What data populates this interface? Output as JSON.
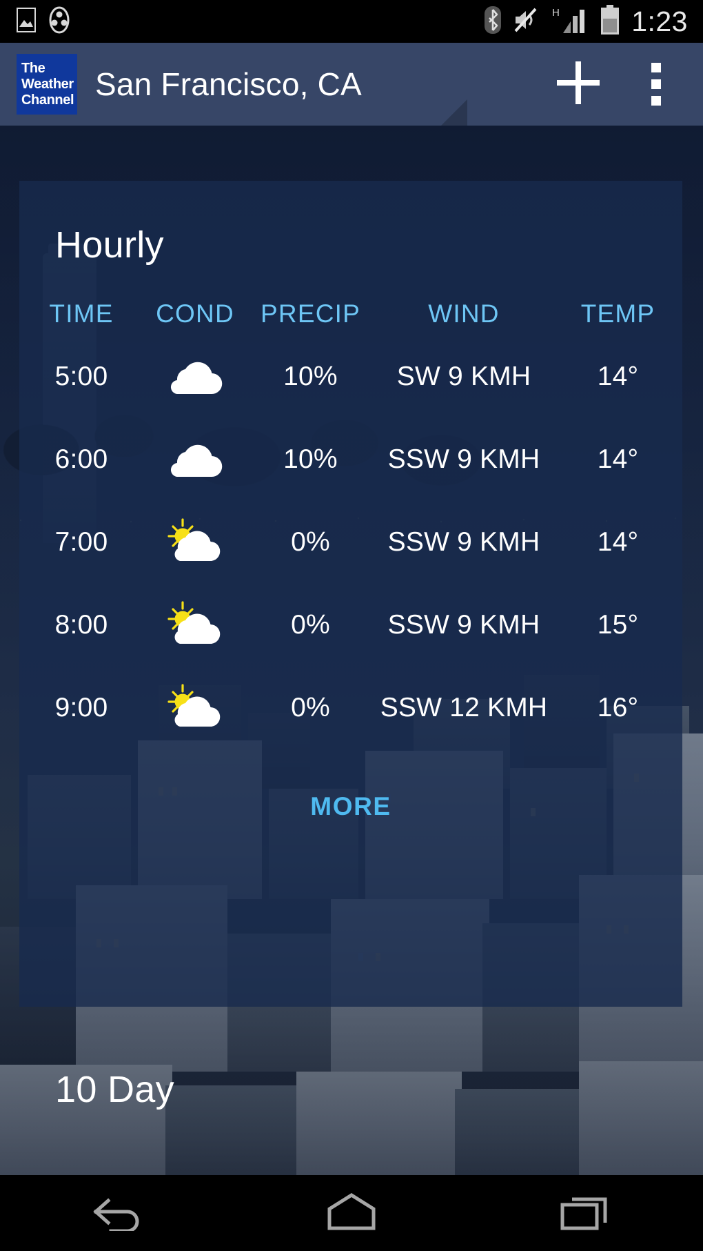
{
  "status_bar": {
    "icons": [
      "image-icon",
      "media-icon",
      "bluetooth-icon",
      "mute-icon",
      "hspa-signal-icon",
      "battery-icon"
    ],
    "network_letter": "H",
    "clock": "1:23"
  },
  "app_bar": {
    "logo_lines": [
      "The",
      "Weather",
      "Channel"
    ],
    "title": "San Francisco, CA",
    "add_label": "+",
    "overflow_label": "More options",
    "background_color": "#374667"
  },
  "hourly_card": {
    "title": "Hourly",
    "columns": [
      "TIME",
      "COND",
      "PRECIP",
      "WIND",
      "TEMP"
    ],
    "header_color": "#6ec6f5",
    "rows": [
      {
        "time": "5:00",
        "cond": "cloudy",
        "precip": "10%",
        "wind": "SW 9 KMH",
        "temp": "14°"
      },
      {
        "time": "6:00",
        "cond": "cloudy",
        "precip": "10%",
        "wind": "SSW 9 KMH",
        "temp": "14°"
      },
      {
        "time": "7:00",
        "cond": "partly-cloudy",
        "precip": "0%",
        "wind": "SSW 9 KMH",
        "temp": "14°"
      },
      {
        "time": "8:00",
        "cond": "partly-cloudy",
        "precip": "0%",
        "wind": "SSW 9 KMH",
        "temp": "15°"
      },
      {
        "time": "9:00",
        "cond": "partly-cloudy",
        "precip": "0%",
        "wind": "SSW 12 KMH",
        "temp": "16°"
      }
    ],
    "more_label": "MORE",
    "more_color": "#4fbaf0"
  },
  "ten_day": {
    "title": "10 Day"
  },
  "nav_bar": {
    "back": "back-icon",
    "home": "home-icon",
    "recents": "recents-icon"
  }
}
